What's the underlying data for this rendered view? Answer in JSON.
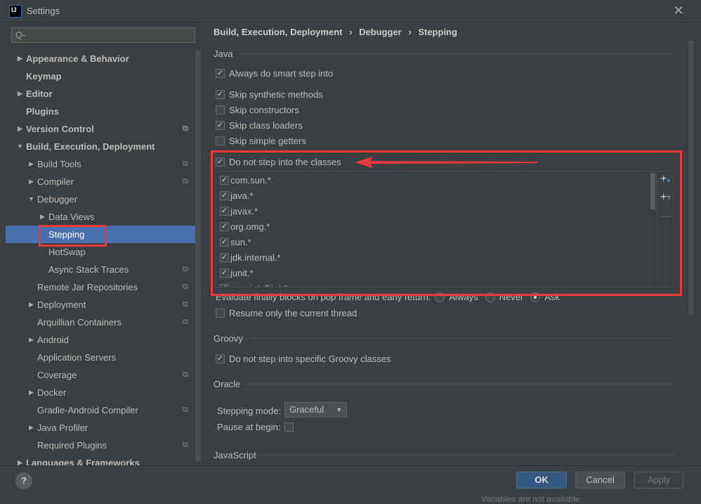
{
  "window": {
    "title": "Settings",
    "logo_text": "IJ",
    "close": "✕"
  },
  "search": {
    "placeholder": "Q-"
  },
  "tree": [
    {
      "label": "Appearance & Behavior",
      "level": 0,
      "arrow": "right",
      "bold": true
    },
    {
      "label": "Keymap",
      "level": 0,
      "bold": true
    },
    {
      "label": "Editor",
      "level": 0,
      "arrow": "right",
      "bold": true
    },
    {
      "label": "Plugins",
      "level": 0,
      "bold": true
    },
    {
      "label": "Version Control",
      "level": 0,
      "arrow": "right",
      "bold": true,
      "copy": true
    },
    {
      "label": "Build, Execution, Deployment",
      "level": 0,
      "arrow": "down",
      "bold": true
    },
    {
      "label": "Build Tools",
      "level": 1,
      "arrow": "right",
      "copy": true
    },
    {
      "label": "Compiler",
      "level": 1,
      "arrow": "right",
      "copy": true
    },
    {
      "label": "Debugger",
      "level": 1,
      "arrow": "down"
    },
    {
      "label": "Data Views",
      "level": 2,
      "arrow": "right"
    },
    {
      "label": "Stepping",
      "level": 2,
      "selected": true
    },
    {
      "label": "HotSwap",
      "level": 2
    },
    {
      "label": "Async Stack Traces",
      "level": 2,
      "copy": true
    },
    {
      "label": "Remote Jar Repositories",
      "level": 1,
      "copy": true
    },
    {
      "label": "Deployment",
      "level": 1,
      "arrow": "right",
      "copy": true
    },
    {
      "label": "Arquillian Containers",
      "level": 1,
      "copy": true
    },
    {
      "label": "Android",
      "level": 1,
      "arrow": "right"
    },
    {
      "label": "Application Servers",
      "level": 1
    },
    {
      "label": "Coverage",
      "level": 1,
      "copy": true
    },
    {
      "label": "Docker",
      "level": 1,
      "arrow": "right"
    },
    {
      "label": "Gradle-Android Compiler",
      "level": 1,
      "copy": true
    },
    {
      "label": "Java Profiler",
      "level": 1,
      "arrow": "right"
    },
    {
      "label": "Required Plugins",
      "level": 1,
      "copy": true
    },
    {
      "label": "Languages & Frameworks",
      "level": 0,
      "arrow": "right",
      "bold": true
    }
  ],
  "breadcrumb": [
    "Build, Execution, Deployment",
    "Debugger",
    "Stepping"
  ],
  "breadcrumb_sep": "›",
  "java": {
    "title": "Java",
    "options": [
      {
        "label": "Always do smart step into",
        "checked": true
      },
      {
        "label": "Skip synthetic methods",
        "checked": true
      },
      {
        "label": "Skip constructors",
        "checked": false
      },
      {
        "label": "Skip class loaders",
        "checked": true
      },
      {
        "label": "Skip simple getters",
        "checked": false
      },
      {
        "label": "Do not step into the classes",
        "checked": true
      }
    ],
    "classes": [
      "com.sun.*",
      "java.*",
      "javax.*",
      "org.omg.*",
      "sun.*",
      "jdk.internal.*",
      "junit.*",
      "com.intellij.rt.*"
    ],
    "evaluate_label": "Evaluate finally blocks on pop frame and early return:",
    "evaluate_options": [
      {
        "label": "Always",
        "selected": false
      },
      {
        "label": "Never",
        "selected": false
      },
      {
        "label": "Ask",
        "selected": true
      }
    ],
    "resume_label": "Resume only the current thread",
    "resume_checked": false
  },
  "groovy": {
    "title": "Groovy",
    "option": "Do not step into specific Groovy classes",
    "checked": true
  },
  "oracle": {
    "title": "Oracle",
    "stepping_mode_label": "Stepping mode:",
    "stepping_mode_value": "Graceful",
    "pause_label": "Pause at begin:",
    "pause_checked": false
  },
  "javascript": {
    "title": "JavaScript"
  },
  "buttons": {
    "ok": "OK",
    "cancel": "Cancel",
    "apply": "Apply",
    "help": "?"
  },
  "background_text": "Variables are not available",
  "colors": {
    "selection": "#4b6eaf",
    "annotation": "#e8393c",
    "ok_button": "#365880"
  }
}
